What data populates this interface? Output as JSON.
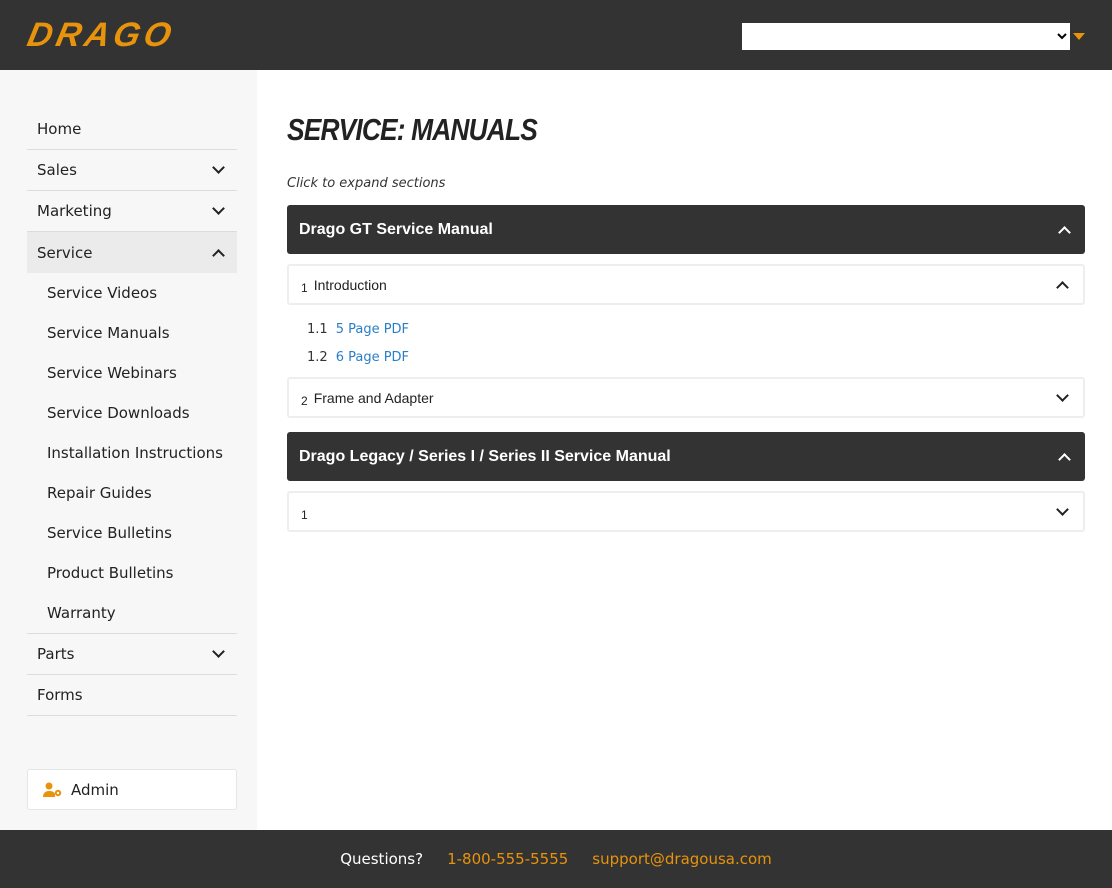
{
  "header": {
    "logo": "DRAGO",
    "select_value": "",
    "brand_color": "#e8930c"
  },
  "sidebar": {
    "items": [
      {
        "label": "Home"
      },
      {
        "label": "Sales"
      },
      {
        "label": "Marketing"
      },
      {
        "label": "Service"
      }
    ],
    "service_sub": [
      "Service Videos",
      "Service Manuals",
      "Service Webinars",
      "Service Downloads",
      "Installation Instructions",
      "Repair Guides",
      "Service Bulletins",
      "Product Bulletins",
      "Warranty"
    ],
    "after": [
      {
        "label": "Parts"
      },
      {
        "label": "Forms"
      }
    ],
    "admin": "Admin"
  },
  "main": {
    "title": "SERVICE: MANUALS",
    "hint": "Click to expand sections",
    "manuals": [
      {
        "title": "Drago GT Service Manual",
        "sections": [
          {
            "num": "1",
            "label": "Introduction",
            "links": [
              {
                "num": "1.1",
                "label": "5 Page PDF"
              },
              {
                "num": "1.2",
                "label": "6 Page PDF"
              }
            ]
          },
          {
            "num": "2",
            "label": "Frame and Adapter"
          }
        ]
      },
      {
        "title": "Drago Legacy / Series I / Series II Service Manual",
        "sections": [
          {
            "num": "1",
            "label": ""
          }
        ]
      }
    ]
  },
  "footer": {
    "questions": "Questions?",
    "phone": "1-800-555-5555",
    "email": "support@dragousa.com"
  }
}
